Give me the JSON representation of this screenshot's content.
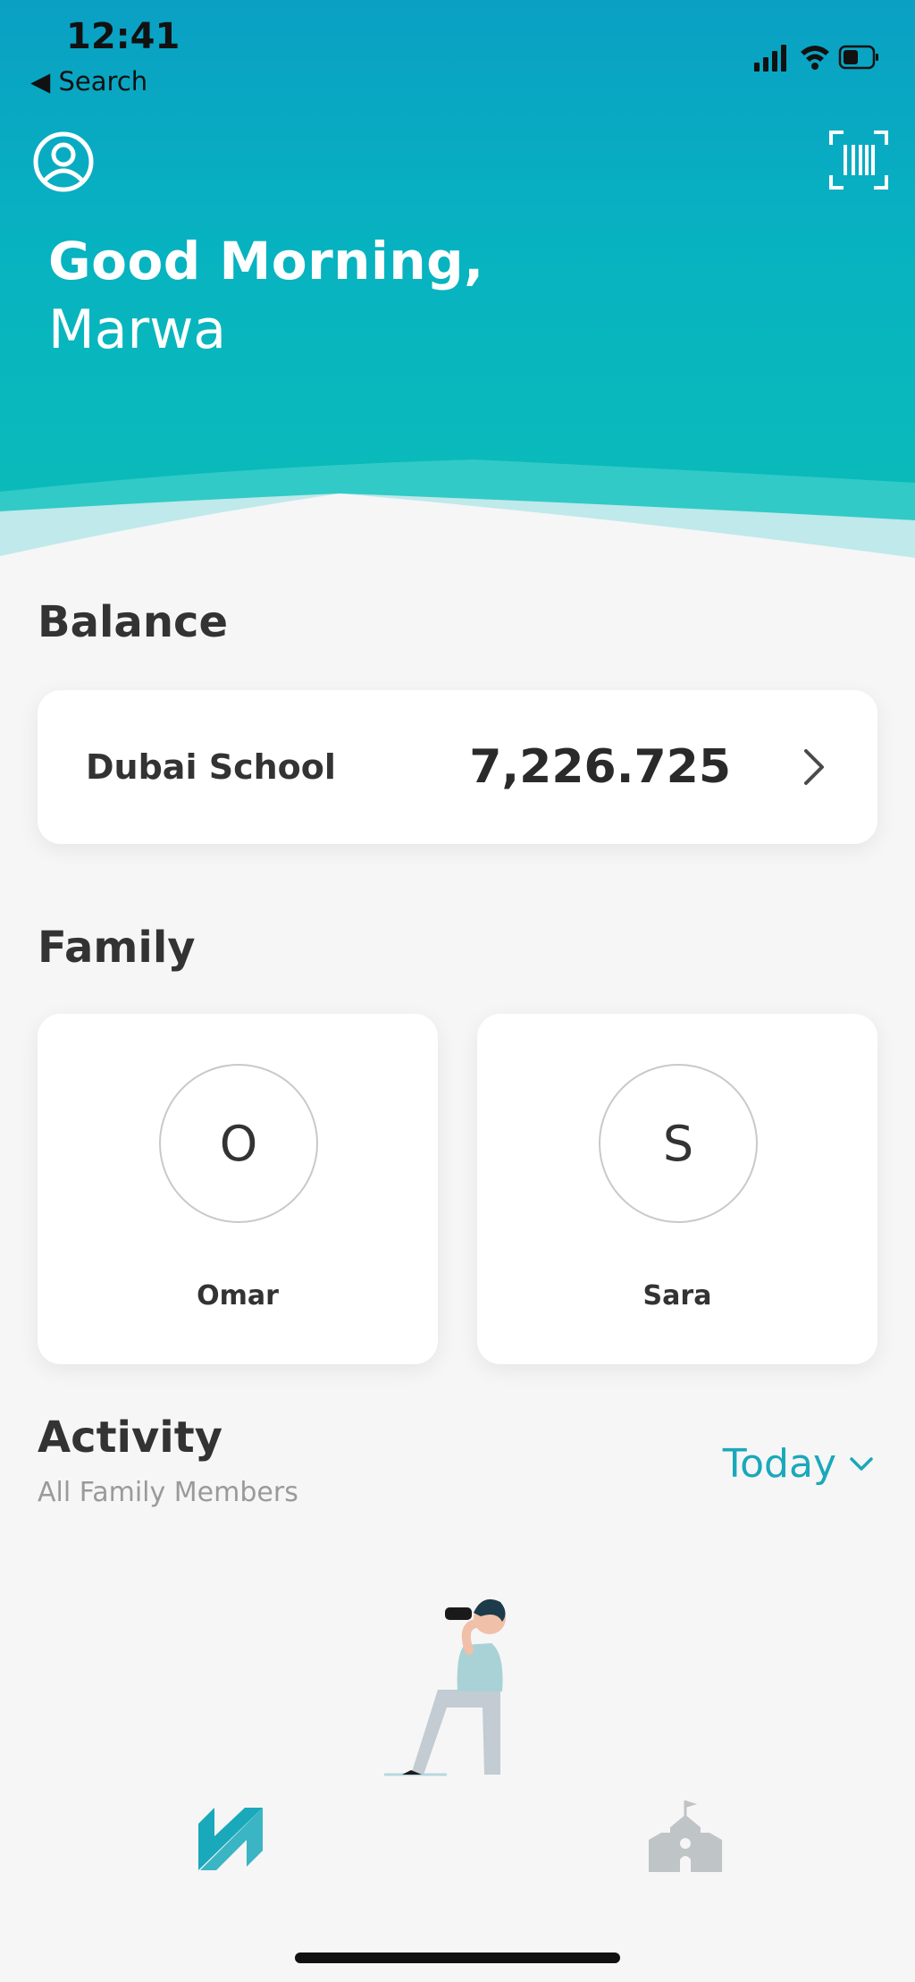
{
  "status_bar": {
    "time": "12:41",
    "back_label": "◀ Search"
  },
  "header": {
    "greeting": "Good Morning,",
    "user_name": "Marwa"
  },
  "balance": {
    "section_title": "Balance",
    "account_name": "Dubai School",
    "amount": "7,226.725"
  },
  "family": {
    "section_title": "Family",
    "members": [
      {
        "initial": "O",
        "name": "Omar"
      },
      {
        "initial": "S",
        "name": "Sara"
      }
    ]
  },
  "activity": {
    "section_title": "Activity",
    "subtitle": "All Family Members",
    "filter_label": "Today"
  },
  "colors": {
    "accent": "#1aa8bb",
    "header_top": "#0aa0c4",
    "header_bottom": "#0bbdb9"
  },
  "icons": {
    "profile": "profile-icon",
    "scan": "barcode-scan-icon",
    "chevron": "chevron-right-icon",
    "dropdown": "chevron-down-icon",
    "nav_home": "app-logo-icon",
    "nav_school": "school-icon"
  }
}
